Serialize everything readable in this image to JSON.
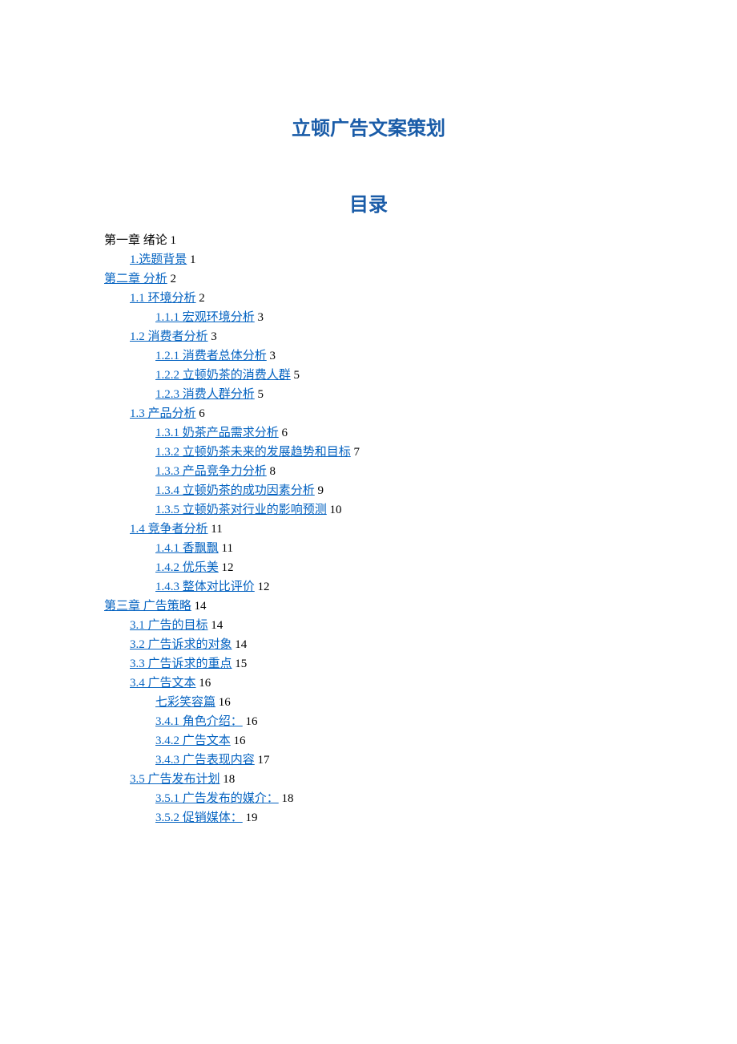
{
  "document_title": "立顿广告文案策划",
  "toc_heading": "目录",
  "toc_entries": [
    {
      "level": 0,
      "label": "第一章 绪论",
      "page": "1",
      "link": false
    },
    {
      "level": 1,
      "label": "1.选题背景",
      "page": "1",
      "link": true
    },
    {
      "level": 0,
      "label": "第二章 分析",
      "page": "2",
      "link": true
    },
    {
      "level": 1,
      "label": "1.1  环境分析",
      "page": "2",
      "link": true
    },
    {
      "level": 2,
      "label": "1.1.1  宏观环境分析",
      "page": "3",
      "link": true
    },
    {
      "level": 1,
      "label": "1.2 消费者分析",
      "page": "3",
      "link": true
    },
    {
      "level": 2,
      "label": "1.2.1  消费者总体分析",
      "page": "3",
      "link": true
    },
    {
      "level": 2,
      "label": "1.2.2 立顿奶茶的消费人群",
      "page": "5",
      "link": true
    },
    {
      "level": 2,
      "label": "1.2.3  消费人群分析",
      "page": "5",
      "link": true
    },
    {
      "level": 1,
      "label": "1.3  产品分析",
      "page": "6",
      "link": true
    },
    {
      "level": 2,
      "label": "1.3.1 奶茶产品需求分析",
      "page": "6",
      "link": true
    },
    {
      "level": 2,
      "label": "1.3.2  立顿奶茶未来的发展趋势和目标",
      "page": "7",
      "link": true
    },
    {
      "level": 2,
      "label": "1.3.3 产品竞争力分析",
      "page": "8",
      "link": true
    },
    {
      "level": 2,
      "label": "1.3.4  立顿奶茶的成功因素分析",
      "page": "9",
      "link": true
    },
    {
      "level": 2,
      "label": "1.3.5 立顿奶茶对行业的影响预测",
      "page": "10",
      "link": true
    },
    {
      "level": 1,
      "label": "1.4  竞争者分析",
      "page": "11",
      "link": true
    },
    {
      "level": 2,
      "label": "1.4.1  香飘飘",
      "page": "11",
      "link": true
    },
    {
      "level": 2,
      "label": "1.4.2  优乐美",
      "page": "12",
      "link": true
    },
    {
      "level": 2,
      "label": "1.4.3  整体对比评价",
      "page": "12",
      "link": true
    },
    {
      "level": 0,
      "label": "第三章 广告策略",
      "page": "14",
      "link": true
    },
    {
      "level": 1,
      "label": "3.1 广告的目标",
      "page": "14",
      "link": true
    },
    {
      "level": 1,
      "label": "3.2 广告诉求的对象",
      "page": "14",
      "link": true
    },
    {
      "level": 1,
      "label": "3.3 广告诉求的重点",
      "page": "15",
      "link": true
    },
    {
      "level": 1,
      "label": "3.4  广告文本",
      "page": "16",
      "link": true
    },
    {
      "level": 2,
      "label": "七彩笑容篇",
      "page": "16",
      "link": true
    },
    {
      "level": 2,
      "label": "3.4.1 角色介绍：",
      "page": "16",
      "link": true
    },
    {
      "level": 2,
      "label": "3.4.2 广告文本",
      "page": "16",
      "link": true
    },
    {
      "level": 2,
      "label": "3.4.3 广告表现内容",
      "page": "17",
      "link": true
    },
    {
      "level": 1,
      "label": "3.5 广告发布计划",
      "page": "18",
      "link": true
    },
    {
      "level": 2,
      "label": "3.5.1 广告发布的媒介：",
      "page": "18",
      "link": true
    },
    {
      "level": 2,
      "label": "3.5.2 促销媒体：",
      "page": "19",
      "link": true
    }
  ]
}
